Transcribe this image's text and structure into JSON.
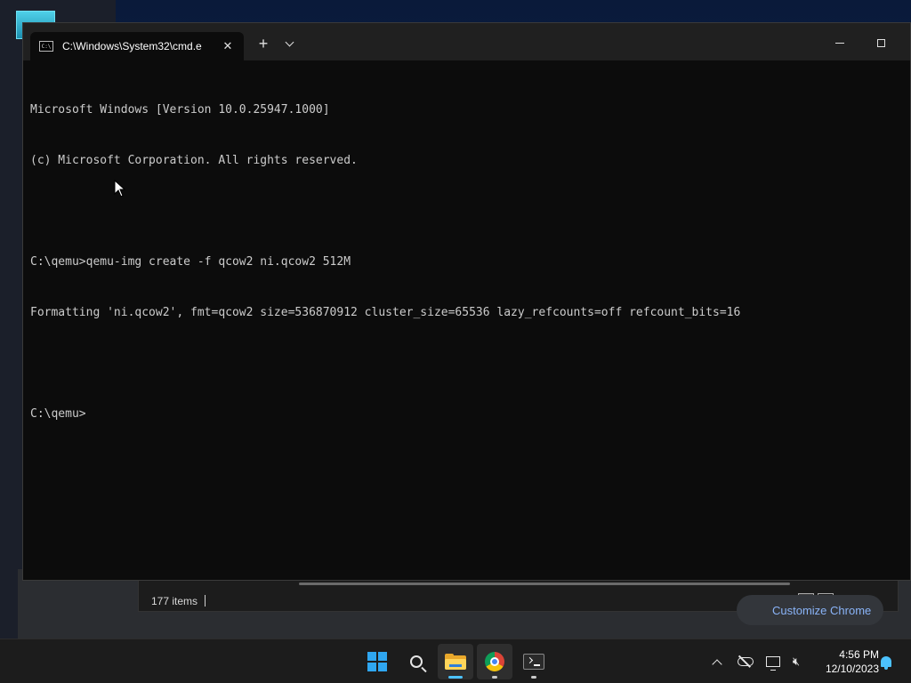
{
  "terminal": {
    "tab_title": "C:\\Windows\\System32\\cmd.e",
    "tab_icon_text": "C:\\",
    "new_tab_symbol": "+",
    "close_symbol": "✕",
    "lines": [
      "Microsoft Windows [Version 10.0.25947.1000]",
      "(c) Microsoft Corporation. All rights reserved.",
      "",
      "C:\\qemu>qemu-img create -f qcow2 ni.qcow2 512M",
      "Formatting 'ni.qcow2', fmt=qcow2 size=536870912 cluster_size=65536 lazy_refcounts=off refcount_bits=16",
      "",
      "C:\\qemu>"
    ]
  },
  "explorer": {
    "item_count": "177 items"
  },
  "chrome": {
    "customize_label": "Customize Chrome"
  },
  "taskbar": {
    "apps": [
      {
        "name": "start-icon"
      },
      {
        "name": "search-icon"
      },
      {
        "name": "file-explorer-icon",
        "active": true
      },
      {
        "name": "chrome-icon",
        "running": true
      },
      {
        "name": "terminal-icon",
        "running": true
      }
    ],
    "tray": {
      "time": "4:56 PM",
      "date": "12/10/2023"
    }
  },
  "colors": {
    "console_text": "#cccccc",
    "console_bg": "#0c0c0c",
    "accent": "#4cc2ff"
  }
}
